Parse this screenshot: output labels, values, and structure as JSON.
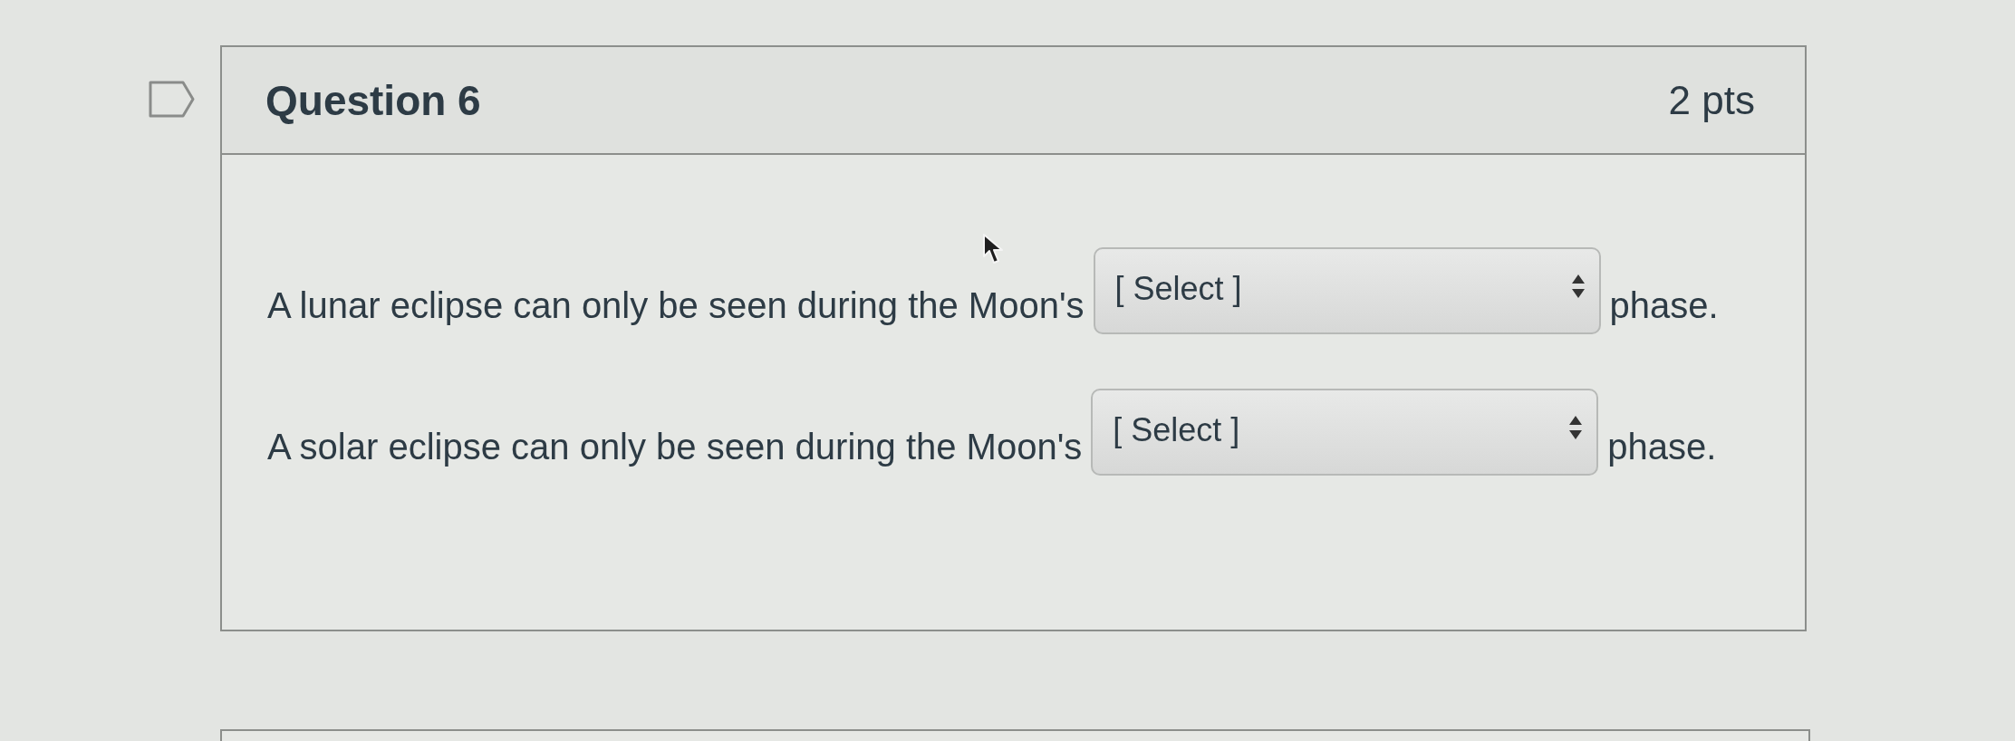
{
  "question": {
    "title": "Question 6",
    "points": "2 pts",
    "flagged": false
  },
  "blanks": [
    {
      "before": "A lunar eclipse can only be seen during the Moon's",
      "value": "[ Select ]",
      "after": "phase."
    },
    {
      "before": "A solar eclipse can only be seen during the Moon's",
      "value": "[ Select ]",
      "after": "phase."
    }
  ]
}
